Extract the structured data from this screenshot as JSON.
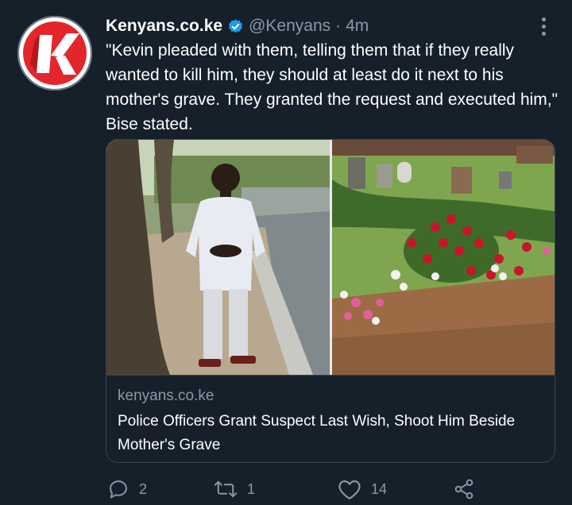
{
  "tweet": {
    "author_name": "Kenyans.co.ke",
    "handle": "@Kenyans",
    "separator": "·",
    "time": "4m",
    "text": "\"Kevin pleaded with them, telling them that if they really wanted to kill him, they should at least do it next to his mother's grave. They granted the request and executed him,\" Bise stated."
  },
  "card": {
    "domain": "kenyans.co.ke",
    "title": "Police Officers Grant Suspect Last Wish, Shoot Him Beside Mother's Grave"
  },
  "actions": {
    "replies": "2",
    "retweets": "1",
    "likes": "14"
  },
  "icons": {
    "avatar": "kenyans-logo",
    "verified": "verified-badge-icon",
    "more": "more-options-icon",
    "reply": "reply-icon",
    "retweet": "retweet-icon",
    "like": "heart-icon",
    "share": "share-icon"
  },
  "colors": {
    "background": "#15202b",
    "secondary_text": "#8b98a5",
    "border": "#38444d",
    "verified": "#1d9bf0",
    "logo_red": "#e3262c"
  }
}
